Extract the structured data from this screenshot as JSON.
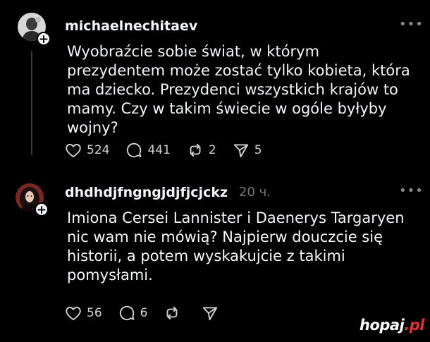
{
  "posts": [
    {
      "username": "michaelnechitaev",
      "timestamp": "",
      "text": "Wyobraźcie sobie świat, w którym\nprezydentem może zostać tylko kobieta, która\nma dziecko. Prezydenci wszystkich krajów to\nmamy. Czy w takim świecie w ogóle byłyby\nwojny?",
      "likes": "524",
      "replies": "441",
      "reposts": "2",
      "shares": "5"
    },
    {
      "username": "dhdhdjfngngjdjfjcjckz",
      "timestamp": "20 ч.",
      "text": "Imiona Cersei Lannister i Daenerys Targaryen\nnic wam nie mówią? Najpierw douczcie się\nhistorii, a potem wyskakujcie z takimi\npomysłami.",
      "likes": "56",
      "replies": "6",
      "reposts": "",
      "shares": ""
    }
  ],
  "watermark": {
    "name": "hopaj",
    "tld": ".pl"
  },
  "colors": {
    "background": "#000000",
    "text": "#f3f5f7",
    "muted": "#777777",
    "thread_line": "#3a3a3a",
    "watermark_accent": "#e03434"
  }
}
